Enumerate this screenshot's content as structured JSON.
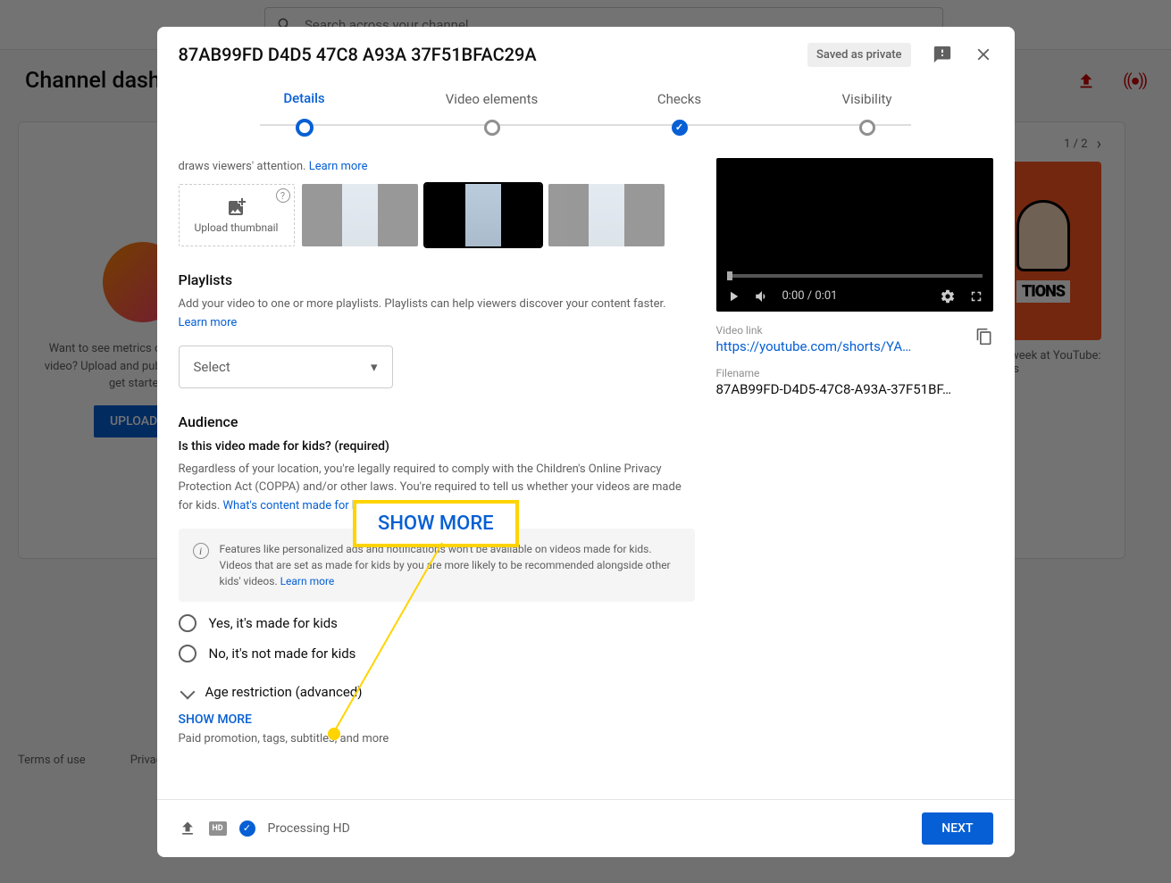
{
  "topbar": {
    "search_placeholder": "Search across your channel"
  },
  "page": {
    "title": "Channel dashboard"
  },
  "dashboard": {
    "metrics_text": "Want to see metrics on your recent video? Upload and publish a video to get started.",
    "upload_btn": "UPLOAD VIDEOS",
    "pager": "1 / 2",
    "news_caption": "This week at YouTube: Shorts",
    "news_img_text": "TIONS"
  },
  "footer": {
    "terms": "Terms of use",
    "privacy": "Privacy policy"
  },
  "dialog": {
    "title": "87AB99FD D4D5 47C8 A93A 37F51BFAC29A",
    "badge": "Saved as private",
    "steps": [
      "Details",
      "Video elements",
      "Checks",
      "Visibility"
    ],
    "thumb_trunc": "draws viewers' attention. ",
    "thumb_learn": "Learn more",
    "upload_thumb": "Upload thumbnail",
    "playlists_h": "Playlists",
    "playlists_d": "Add your video to one or more playlists. Playlists can help viewers discover your content faster. ",
    "playlists_learn": "Learn more",
    "select": "Select",
    "audience_h": "Audience",
    "audience_q": "Is this video made for kids? (required)",
    "audience_d": "Regardless of your location, you're legally required to comply with the Children's Online Privacy Protection Act (COPPA) and/or other laws. You're required to tell us whether your videos are made for kids. ",
    "audience_link": "What's content made for kids?",
    "info": "Features like personalized ads and notifications won't be available on videos made for kids. Videos that are set as made for kids by you are more likely to be recommended alongside other kids' videos. ",
    "info_learn": "Learn more",
    "radio_yes": "Yes, it's made for kids",
    "radio_no": "No, it's not made for kids",
    "age_restrict": "Age restriction (advanced)",
    "show_more": "SHOW MORE",
    "show_more_sub": "Paid promotion, tags, subtitles, and more",
    "video_link_lbl": "Video link",
    "video_link": "https://youtube.com/shorts/YA…",
    "filename_lbl": "Filename",
    "filename": "87AB99FD-D4D5-47C8-A93A-37F51BF…",
    "time": "0:00 / 0:01",
    "processing": "Processing HD",
    "next": "NEXT"
  },
  "callout": {
    "text": "SHOW MORE"
  }
}
